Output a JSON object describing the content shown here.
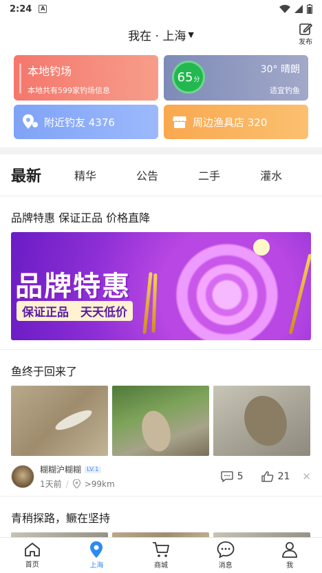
{
  "status_bar": {
    "time": "2:24",
    "a_icon": "A"
  },
  "header": {
    "location_label": "我在 · 上海",
    "publish_label": "发布"
  },
  "cards": {
    "local": {
      "title": "本地钓场",
      "subtitle": "本地共有599家钓场信息"
    },
    "weather": {
      "score": "65",
      "score_unit": "分",
      "temperature": "30° 晴朗",
      "tip": "适宜钓鱼"
    },
    "friends": {
      "label": "附近钓友 4376"
    },
    "shops": {
      "label": "周边渔具店 320"
    }
  },
  "tabs": {
    "main": "最新",
    "items": [
      "精华",
      "公告",
      "二手",
      "灌水"
    ]
  },
  "posts": [
    {
      "title": "品牌特惠 保证正品 价格直降",
      "banner_text": "品牌特惠",
      "banner_sub": "保证正品　天天低价"
    },
    {
      "title": "鱼终于回来了",
      "author": "糊糊沪糊糊",
      "level": "LV.1",
      "time": "1天前",
      "distance": ">99km",
      "comments": "5",
      "likes": "21"
    },
    {
      "title": "青稍探路，鳜在坚持"
    }
  ],
  "bottom_nav": [
    {
      "label": "首页"
    },
    {
      "label": "上海"
    },
    {
      "label": "商城"
    },
    {
      "label": "消息"
    },
    {
      "label": "我"
    }
  ],
  "colors": {
    "accent": "#2b8bf2",
    "local_card": "#f4776c",
    "weather_card": "#7e8bb8",
    "friends_card": "#7fa3f6",
    "shop_card": "#f9a84f",
    "score_green": "#23b84f"
  }
}
